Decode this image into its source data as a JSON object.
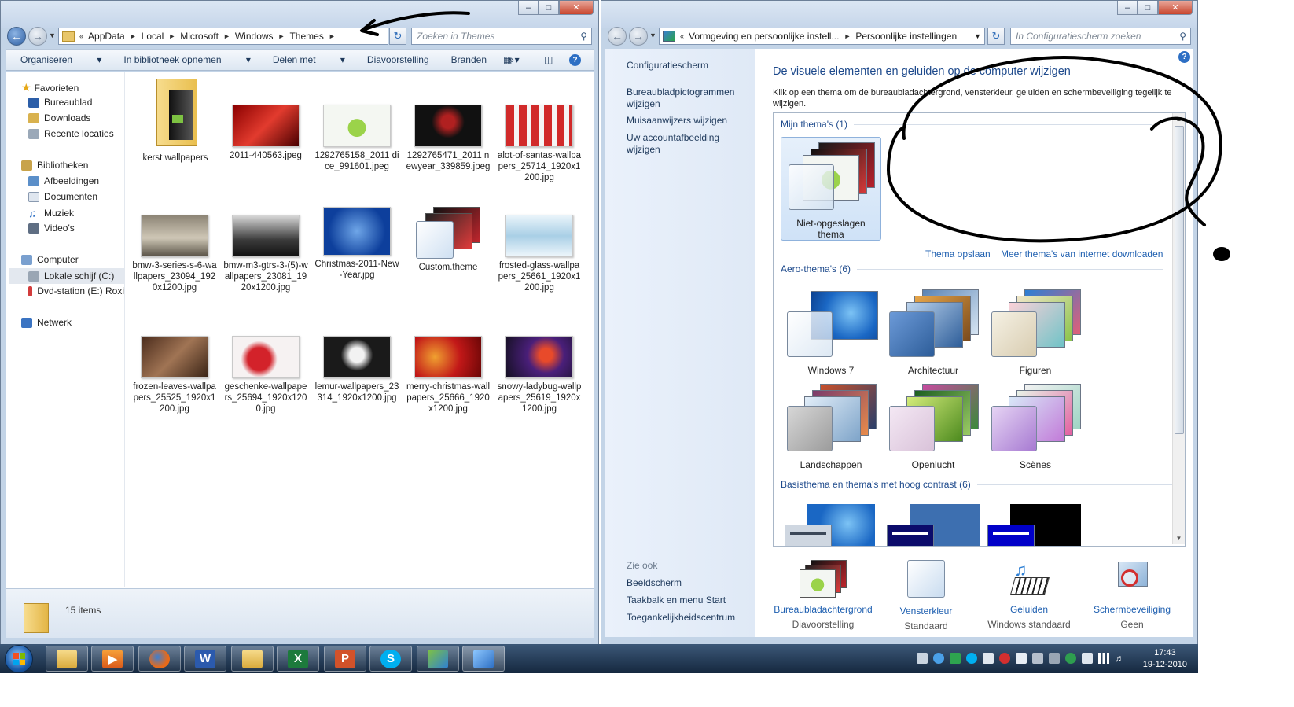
{
  "explorer": {
    "breadcrumb": [
      "AppData",
      "Local",
      "Microsoft",
      "Windows",
      "Themes"
    ],
    "search_placeholder": "Zoeken in Themes",
    "toolbar": [
      "Organiseren",
      "In bibliotheek opnemen",
      "Delen met",
      "Diavoorstelling",
      "Branden"
    ],
    "nav": {
      "favorites": "Favorieten",
      "favorite_items": [
        "Bureaublad",
        "Downloads",
        "Recente locaties"
      ],
      "libraries": "Bibliotheken",
      "library_items": [
        "Afbeeldingen",
        "Documenten",
        "Muziek",
        "Video's"
      ],
      "computer": "Computer",
      "computer_items": [
        "Lokale schijf (C:)",
        "Dvd-station (E:) Roxi"
      ],
      "network": "Netwerk"
    },
    "files": [
      "kerst wallpapers",
      "2011-440563.jpeg",
      "1292765158_2011 dice_991601.jpeg",
      "1292765471_2011 newyear_339859.jpeg",
      "alot-of-santas-wallpapers_25714_1920x1200.jpg",
      "bmw-3-series-s-6-wallpapers_23094_1920x1200.jpg",
      "bmw-m3-gtrs-3-(5)-wallpapers_23081_1920x1200.jpg",
      "Christmas-2011-New-Year.jpg",
      "Custom.theme",
      "frosted-glass-wallpapers_25661_1920x1200.jpg",
      "frozen-leaves-wallpapers_25525_1920x1200.jpg",
      "geschenke-wallpapers_25694_1920x1200.jpg",
      "lemur-wallpapers_23314_1920x1200.jpg",
      "merry-christmas-wallpapers_25666_1920x1200.jpg",
      "snowy-ladybug-wallpapers_25619_1920x1200.jpg"
    ],
    "item_count": "15 items"
  },
  "controlpanel": {
    "breadcrumb": [
      "Vormgeving en persoonlijke instell...",
      "Persoonlijke instellingen"
    ],
    "search_placeholder": "In Configuratiescherm zoeken",
    "home_link": "Configuratiescherm",
    "side_links": [
      "Bureaubladpictogrammen wijzigen",
      "Muisaanwijzers wijzigen",
      "Uw accountafbeelding wijzigen"
    ],
    "see_also_title": "Zie ook",
    "see_also": [
      "Beeldscherm",
      "Taakbalk en menu Start",
      "Toegankelijkheidscentrum"
    ],
    "title": "De visuele elementen en geluiden op de computer wijzigen",
    "description": "Klik op een thema om de bureaubladachtergrond, vensterkleur, geluiden en schermbeveiliging tegelijk te wijzigen.",
    "my_themes_header": "Mijn thema's (1)",
    "my_themes": [
      "Niet-opgeslagen thema"
    ],
    "save_theme": "Thema opslaan",
    "more_themes": "Meer thema's van internet downloaden",
    "aero_header": "Aero-thema's (6)",
    "aero_themes": [
      "Windows 7",
      "Architectuur",
      "Figuren",
      "Landschappen",
      "Openlucht",
      "Scènes"
    ],
    "basic_header": "Basisthema en thema's met hoog contrast (6)",
    "bottom": [
      {
        "label": "Bureaubladachtergrond",
        "value": "Diavoorstelling"
      },
      {
        "label": "Vensterkleur",
        "value": "Standaard"
      },
      {
        "label": "Geluiden",
        "value": "Windows standaard"
      },
      {
        "label": "Schermbeveiliging",
        "value": "Geen"
      }
    ]
  },
  "taskbar": {
    "time": "17:43",
    "date": "19-12-2010"
  }
}
